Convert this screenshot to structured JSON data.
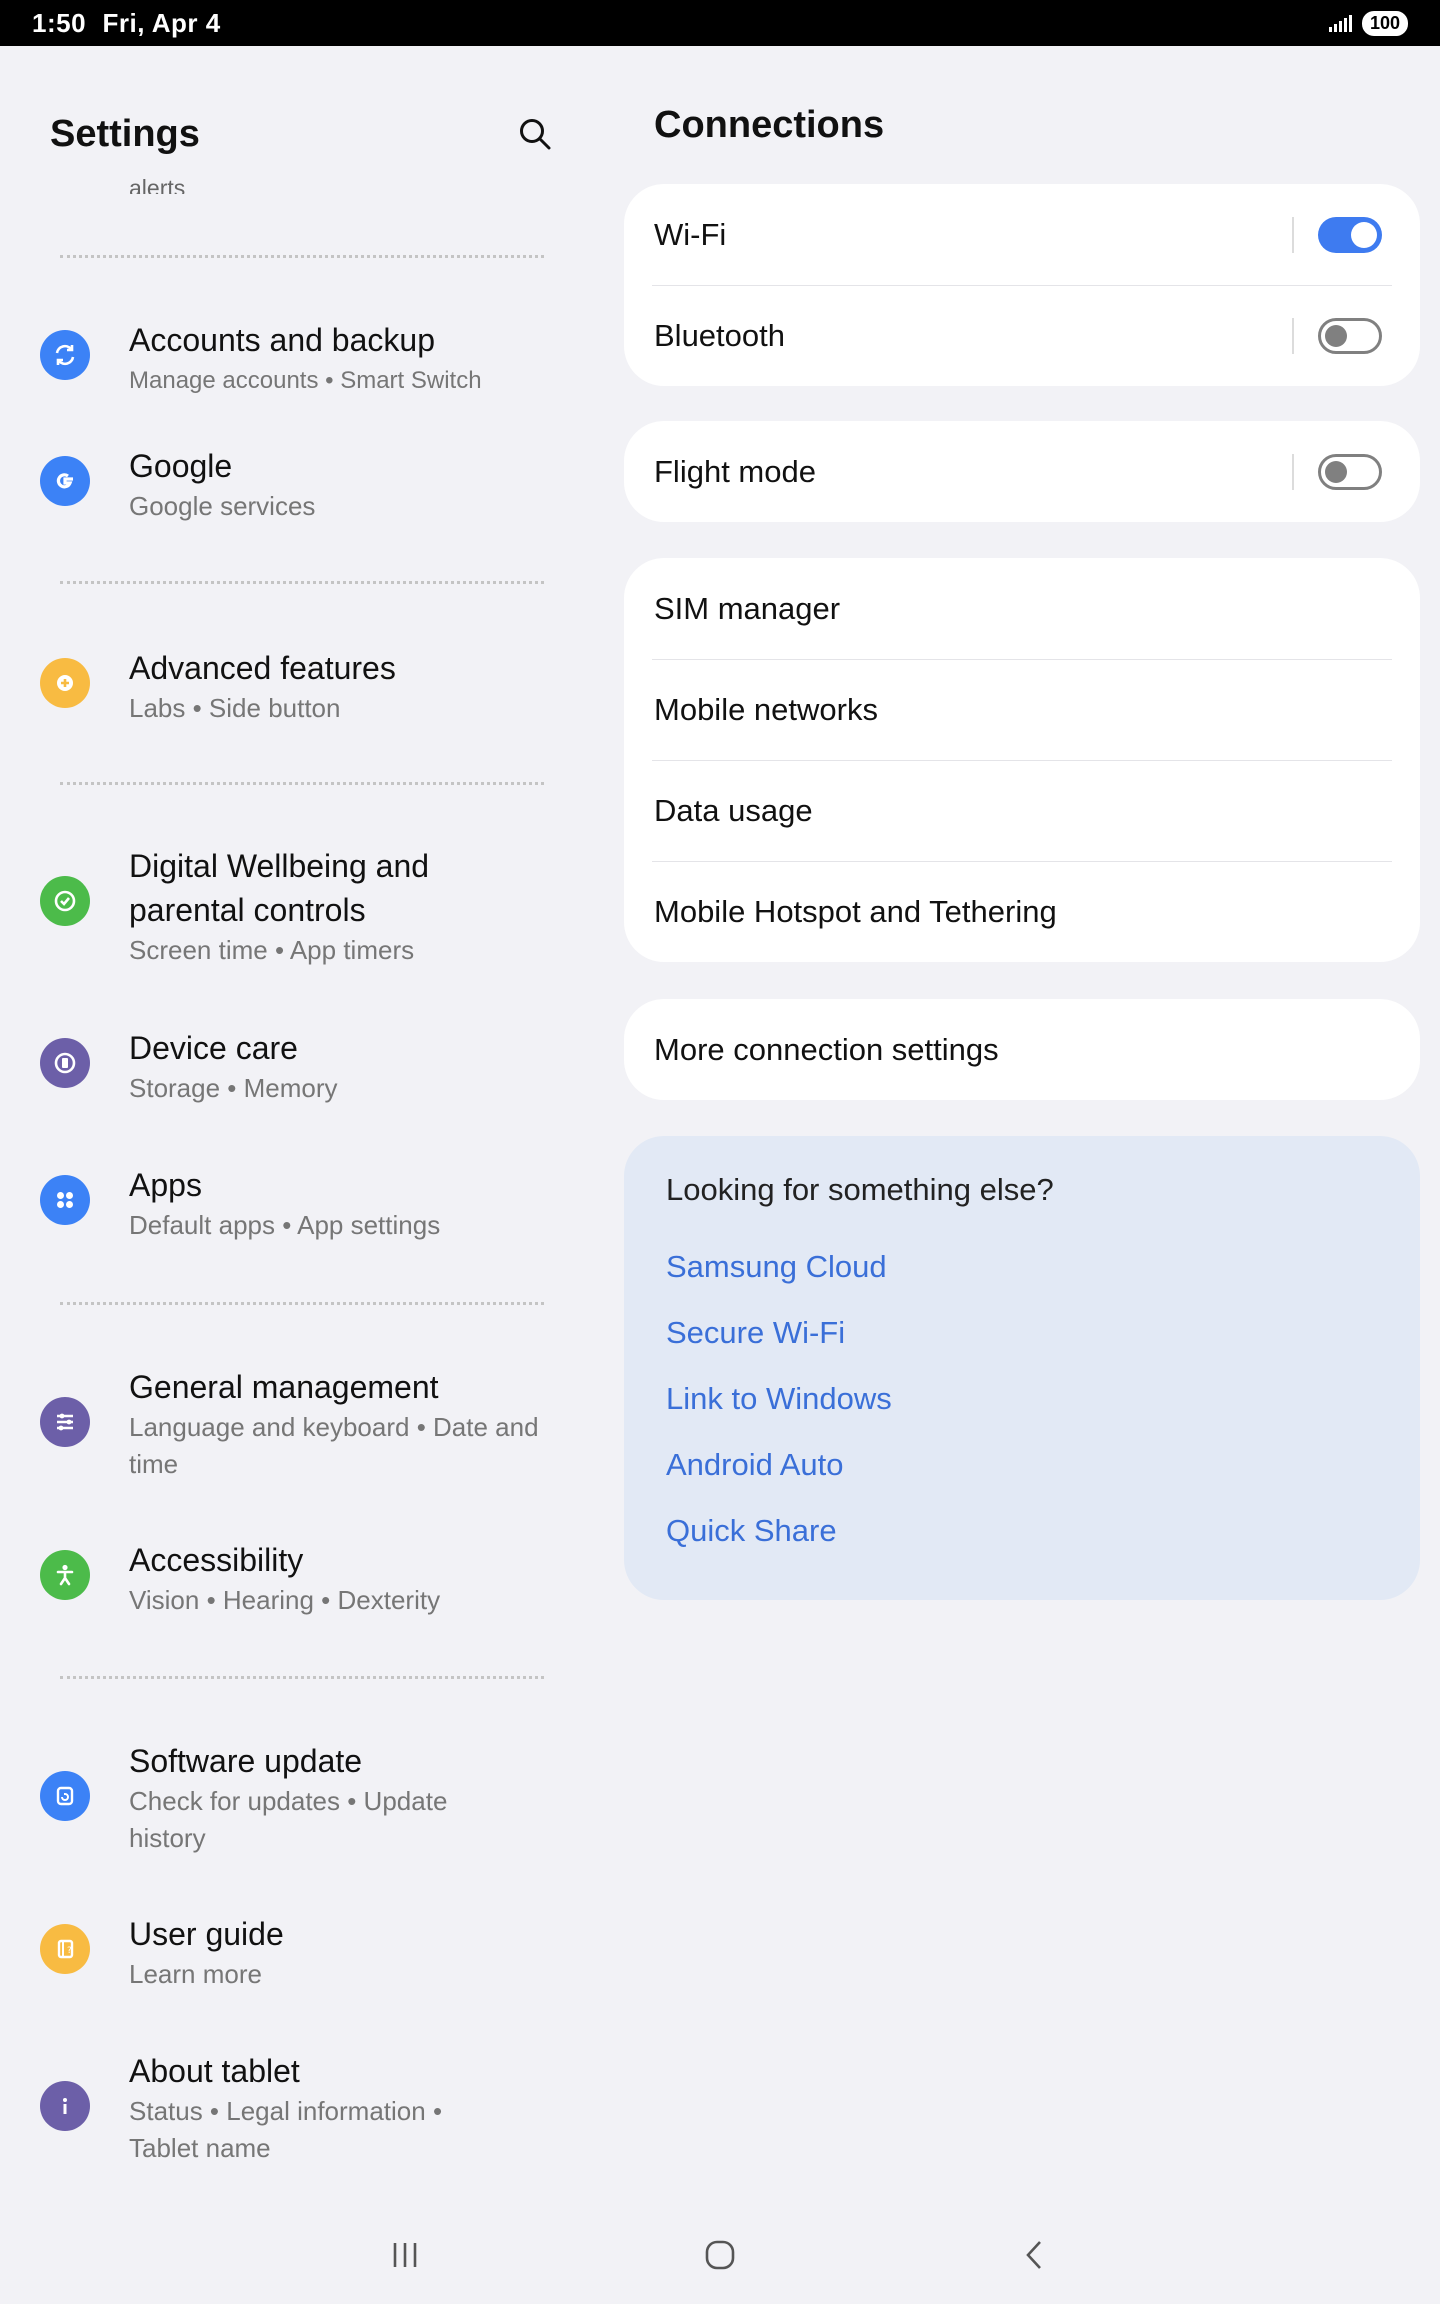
{
  "status_bar": {
    "time": "1:50",
    "date": "Fri, Apr 4",
    "battery": "100"
  },
  "left": {
    "title": "Settings",
    "partial_text": "alerts",
    "items": [
      {
        "name": "accounts",
        "title": "Accounts and backup",
        "subtitle": "Manage accounts  •  Smart Switch",
        "icon": "sync-icon",
        "color": "#3c82f6"
      },
      {
        "name": "google",
        "title": "Google",
        "subtitle": "Google services",
        "icon": "google-g-icon",
        "color": "#3c82f6"
      },
      {
        "name": "advanced",
        "title": "Advanced features",
        "subtitle": "Labs  •  Side button",
        "icon": "gear-plus-icon",
        "color": "#f8bb42"
      },
      {
        "name": "wellbeing",
        "title": "Digital Wellbeing and parental controls",
        "subtitle": "Screen time  •  App timers",
        "icon": "wellbeing-icon",
        "color": "#4cbb4a"
      },
      {
        "name": "device-care",
        "title": "Device care",
        "subtitle": "Storage  •  Memory",
        "icon": "device-care-icon",
        "color": "#6c5fa8"
      },
      {
        "name": "apps",
        "title": "Apps",
        "subtitle": "Default apps  •  App settings",
        "icon": "apps-grid-icon",
        "color": "#3c82f6"
      },
      {
        "name": "general",
        "title": "General management",
        "subtitle": "Language and keyboard  •  Date and time",
        "icon": "sliders-icon",
        "color": "#6c5fa8"
      },
      {
        "name": "accessibility",
        "title": "Accessibility",
        "subtitle": "Vision  •  Hearing  •  Dexterity",
        "icon": "accessibility-icon",
        "color": "#4cbb4a"
      },
      {
        "name": "software",
        "title": "Software update",
        "subtitle": "Check for updates  •  Update history",
        "icon": "update-icon",
        "color": "#3c82f6"
      },
      {
        "name": "user-guide",
        "title": "User guide",
        "subtitle": "Learn more",
        "icon": "guide-book-icon",
        "color": "#f8bb42"
      },
      {
        "name": "about",
        "title": "About tablet",
        "subtitle": "Status  •  Legal information  •  Tablet name",
        "icon": "info-icon",
        "color": "#6c5fa8"
      }
    ]
  },
  "right": {
    "title": "Connections",
    "wifi": {
      "label": "Wi-Fi",
      "on": true
    },
    "bluetooth": {
      "label": "Bluetooth",
      "on": false
    },
    "flight": {
      "label": "Flight mode",
      "on": false
    },
    "sim_group": [
      "SIM manager",
      "Mobile networks",
      "Data usage",
      "Mobile Hotspot and Tethering"
    ],
    "more": "More connection settings",
    "looking": {
      "heading": "Looking for something else?",
      "links": [
        "Samsung Cloud",
        "Secure Wi-Fi",
        "Link to Windows",
        "Android Auto",
        "Quick Share"
      ]
    }
  },
  "colors": {
    "accent": "#3e7bf0",
    "link": "#3a6fd8"
  }
}
